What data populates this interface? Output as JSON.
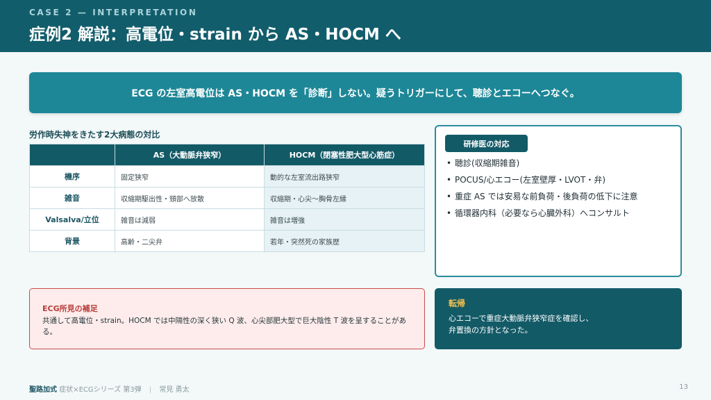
{
  "header": {
    "case_label": "CASE 2 — INTERPRETATION",
    "title": "症例2 解説：高電位・strain から AS・HOCM へ"
  },
  "banner": {
    "text": "ECG の左室高電位は AS・HOCM を「診断」しない。疑うトリガーにして、聴診とエコーへつなぐ。"
  },
  "comparison": {
    "title": "労作時失神をきたす2大病態の対比",
    "headers": [
      "",
      "AS（大動脈弁狭窄）",
      "HOCM（閉塞性肥大型心筋症）"
    ],
    "rows": [
      {
        "label": "機序",
        "as": "固定狭窄",
        "hocm": "動的な左室流出路狭窄"
      },
      {
        "label": "雑音",
        "as": "収縮期駆出性・頸部へ放散",
        "hocm": "収縮期・心尖〜胸骨左縁"
      },
      {
        "label": "Valsalva/立位",
        "as": "雑音は減弱",
        "hocm": "雑音は増強"
      },
      {
        "label": "背景",
        "as": "高齢・二尖弁",
        "hocm": "若年・突然死の家族歴"
      }
    ]
  },
  "resident": {
    "tag": "研修医の対応",
    "items": [
      "聴診(収縮期雑音)",
      "POCUS/心エコー(左室壁厚・LVOT・弁)",
      "重症 AS では安易な前負荷・後負荷の低下に注意",
      "循環器内科（必要なら心臓外科）へコンサルト"
    ]
  },
  "ecg_note": {
    "title": "ECG所見の補足",
    "body": "共通して高電位・strain。HOCM では中隔性の深く狭い Q 波、心尖部肥大型で巨大陰性 T 波を呈することがある。"
  },
  "outcome": {
    "title": "転帰",
    "line1": "心エコーで重症大動脈弁狭窄症を確認し、",
    "line2": "弁置換の方針となった。"
  },
  "footer": {
    "brand": "聖路加式",
    "series": "症状×ECGシリーズ 第3弾",
    "separator": "|",
    "author": "常見 勇太",
    "page": "13"
  }
}
